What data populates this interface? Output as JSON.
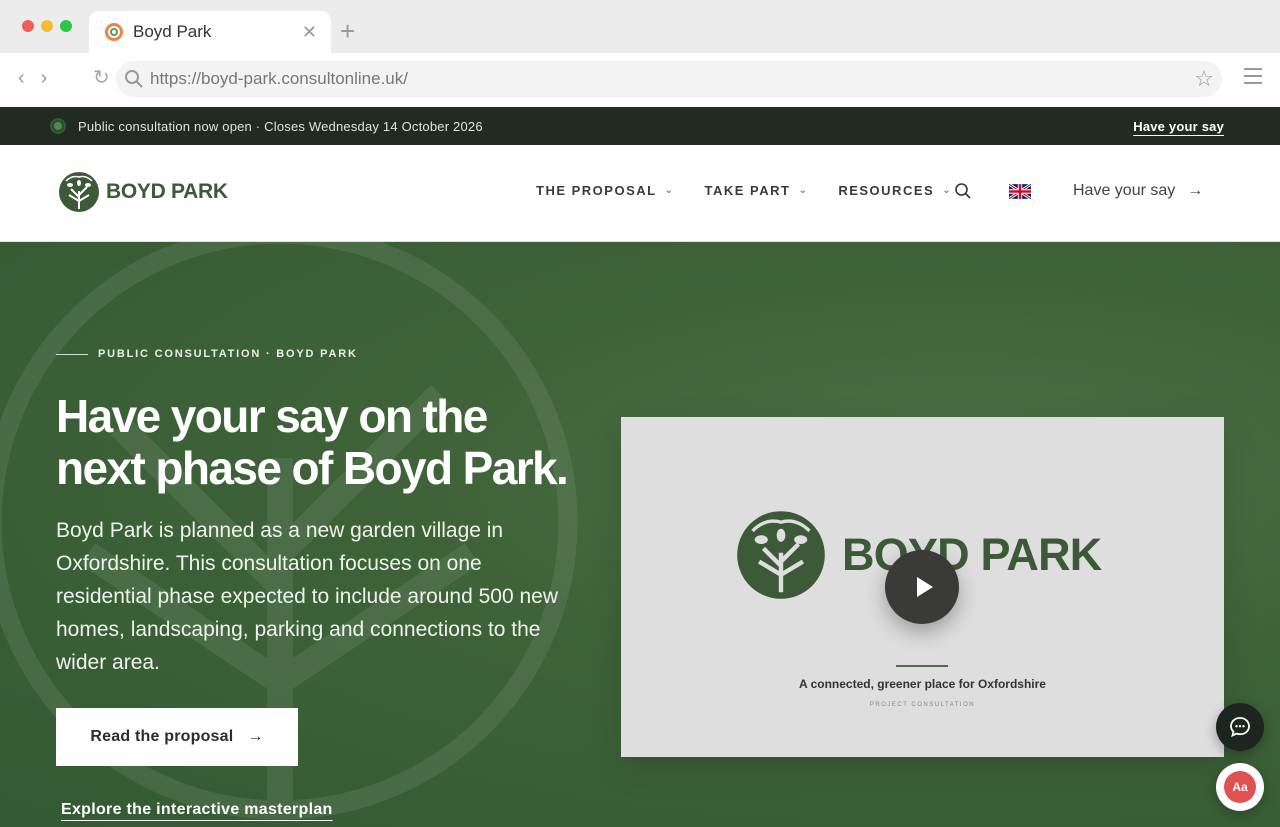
{
  "browser": {
    "tab_title": "Boyd Park",
    "url": "https://boyd-park.consultonline.uk/",
    "traffic_colors": [
      "#ee5f57",
      "#f5bd2f",
      "#28c840"
    ]
  },
  "announcement": {
    "text": "Public consultation now open · Closes Wednesday 14 October 2026",
    "cta": "Have your say"
  },
  "header": {
    "logo_text": "BOYD PARK",
    "nav": [
      {
        "label": "THE PROPOSAL"
      },
      {
        "label": "TAKE PART"
      },
      {
        "label": "RESOURCES"
      }
    ],
    "cta": "Have your say",
    "language_flag": "uk-flag-icon"
  },
  "hero": {
    "eyebrow": "PUBLIC CONSULTATION · BOYD PARK",
    "title_line1": "Have your say on the",
    "title_line2": "next phase of Boyd Park.",
    "lead": "Boyd Park is planned as a new garden village in Oxfordshire. This consultation focuses on one residential phase expected to include around 500 new homes, landscaping, parking and connections to the wider area.",
    "primary_button": "Read the proposal",
    "secondary_link": "Explore the interactive masterplan"
  },
  "video": {
    "logo_text": "BOYD PARK",
    "tagline": "A connected, greener place for Oxfordshire",
    "subtitle": "PROJECT CONSULTATION"
  },
  "floating": {
    "accessibility_label": "Aa"
  },
  "colors": {
    "brand_green": "#3d5a38",
    "hero_bg": "#3f6239",
    "announce_bg": "#232a22"
  }
}
